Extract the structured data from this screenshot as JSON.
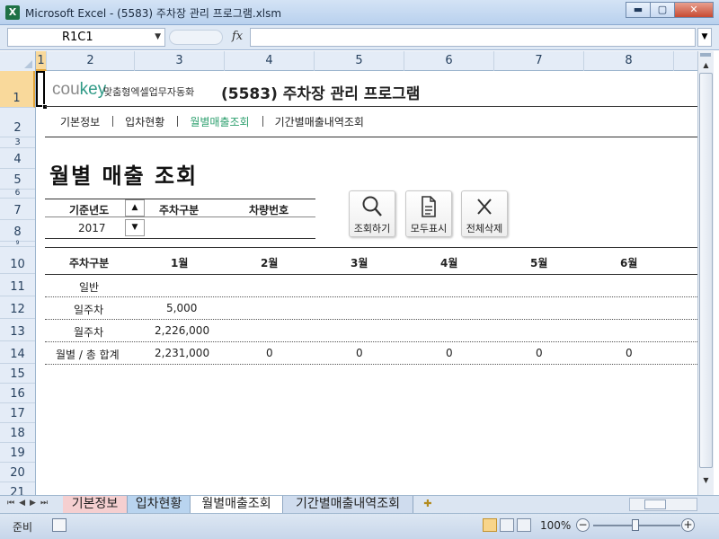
{
  "window": {
    "app_icon": "X",
    "title": "Microsoft Excel - (5583) 주차장 관리 프로그램.xlsm",
    "min_glyph": "▬",
    "max_glyph": "▢",
    "close_glyph": "✕"
  },
  "formula_bar": {
    "name_box": "R1C1",
    "fx": "fx",
    "value": ""
  },
  "columns": [
    "1",
    "2",
    "3",
    "4",
    "5",
    "6",
    "7",
    "8"
  ],
  "rows": [
    "1",
    "2",
    "3",
    "4",
    "5",
    "6",
    "7",
    "8",
    "9",
    "10",
    "11",
    "12",
    "13",
    "14",
    "15",
    "16",
    "17",
    "18",
    "19",
    "20",
    "21"
  ],
  "header": {
    "logo_cou": "cou",
    "logo_key": "key",
    "logo_sub": "맞춤형엑셀업무자동화",
    "title": "(5583) 주차장 관리 프로그램"
  },
  "nav": {
    "items": [
      "기본정보",
      "입차현황",
      "월별매출조회",
      "기간별매출내역조회"
    ],
    "active_index": 2
  },
  "page_title": "월별 매출 조회",
  "filter": {
    "year_label": "기준년도",
    "type_label": "주차구분",
    "plate_label": "차량번호",
    "year_value": "2017"
  },
  "buttons": {
    "search": "조회하기",
    "print": "모두표시",
    "delete_all": "전체삭제"
  },
  "table": {
    "headers": [
      "주차구분",
      "1월",
      "2월",
      "3월",
      "4월",
      "5월",
      "6월"
    ],
    "rows": [
      [
        "일반",
        "",
        "",
        "",
        "",
        "",
        ""
      ],
      [
        "일주차",
        "5,000",
        "",
        "",
        "",
        "",
        ""
      ],
      [
        "월주차",
        "2,226,000",
        "",
        "",
        "",
        "",
        ""
      ],
      [
        "월별 / 총 합계",
        "2,231,000",
        "0",
        "0",
        "0",
        "0",
        "0"
      ]
    ]
  },
  "sheet_tabs": [
    "기본정보",
    "입차현황",
    "월별매출조회",
    "기간별매출내역조회"
  ],
  "sheet_tab_active": 2,
  "status": {
    "mode": "준비",
    "zoom": "100%"
  },
  "colors": {
    "accent_green": "#2ea06f",
    "logo_teal": "#2f9a86",
    "selection": "#f9d99b"
  }
}
